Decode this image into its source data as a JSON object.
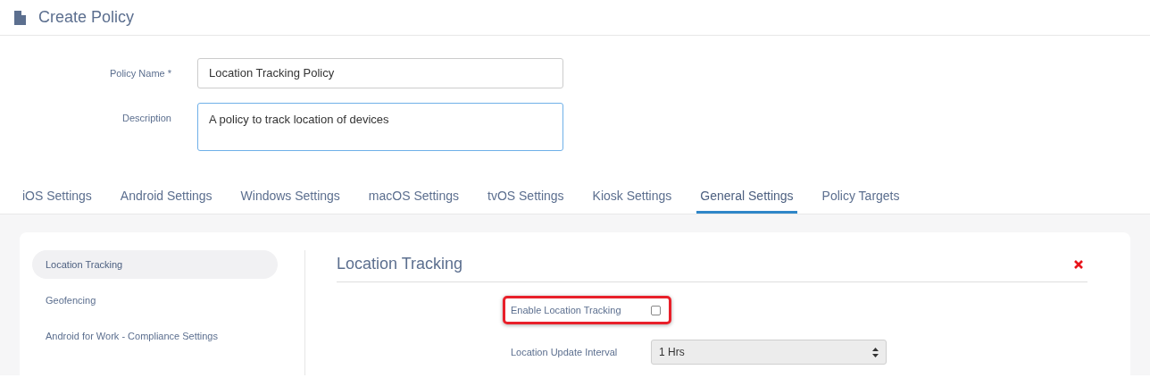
{
  "header": {
    "title": "Create Policy"
  },
  "form": [
    {
      "kind": "input",
      "label": "Policy Name *",
      "value": "Location Tracking Policy",
      "focused": false
    },
    {
      "kind": "textarea",
      "label": "Description",
      "value": "A policy to track location of devices",
      "focused": true
    }
  ],
  "tabs": [
    {
      "label": "iOS Settings",
      "selected": false
    },
    {
      "label": "Android Settings",
      "selected": false
    },
    {
      "label": "Windows Settings",
      "selected": false
    },
    {
      "label": "macOS Settings",
      "selected": false
    },
    {
      "label": "tvOS Settings",
      "selected": false
    },
    {
      "label": "Kiosk Settings",
      "selected": false
    },
    {
      "label": "General Settings",
      "selected": true
    },
    {
      "label": "Policy Targets",
      "selected": false
    }
  ],
  "sidebar": {
    "items": [
      {
        "label": "Location Tracking",
        "selected": true
      },
      {
        "label": "Geofencing",
        "selected": false
      },
      {
        "label": "Android for Work - Compliance Settings",
        "selected": false
      }
    ]
  },
  "section": {
    "title": "Location Tracking",
    "fields": [
      {
        "kind": "checkbox",
        "label": "Enable Location Tracking",
        "checked": false,
        "highlighted": true
      },
      {
        "kind": "select",
        "label": "Location Update Interval",
        "value": "1 Hrs"
      }
    ]
  }
}
